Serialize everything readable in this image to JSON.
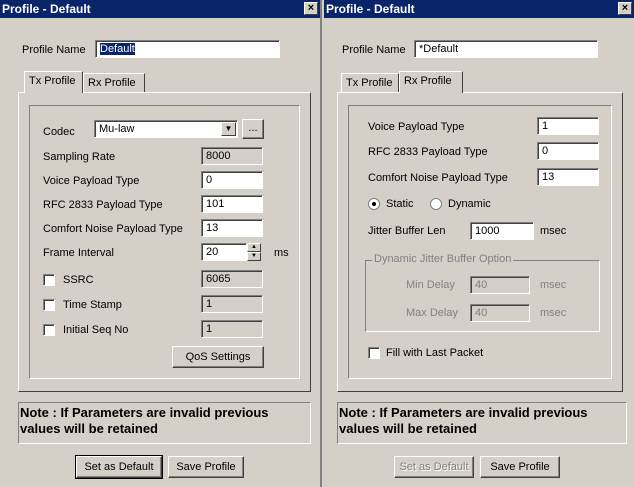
{
  "left": {
    "title": "Profile - Default",
    "close": "×",
    "profile_name_label": "Profile Name",
    "profile_name_value": "Default",
    "tabs": [
      "Tx Profile",
      "Rx Profile"
    ],
    "codec_label": "Codec",
    "codec_value": "Mu-law",
    "codec_more": "...",
    "sampling_rate_label": "Sampling Rate",
    "sampling_rate_value": "8000",
    "voice_payload_label": "Voice Payload Type",
    "voice_payload_value": "0",
    "rfc_label": "RFC 2833 Payload Type",
    "rfc_value": "101",
    "comfort_label": "Comfort Noise Payload Type",
    "comfort_value": "13",
    "frame_label": "Frame Interval",
    "frame_value": "20",
    "frame_unit": "ms",
    "ssrc_label": "SSRC",
    "ssrc_value": "6065",
    "timestamp_label": "Time Stamp",
    "timestamp_value": "1",
    "seq_label": "Initial Seq No",
    "seq_value": "1",
    "qos_button": "QoS Settings",
    "note": "Note : If Parameters are invalid previous values will be retained",
    "set_default_button": "Set as Default",
    "save_button": "Save Profile"
  },
  "right": {
    "title": "Profile - Default",
    "close": "×",
    "profile_name_label": "Profile Name",
    "profile_name_value": "*Default",
    "tabs": [
      "Tx Profile",
      "Rx Profile"
    ],
    "voice_payload_label": "Voice Payload Type",
    "voice_payload_value": "1",
    "rfc_label": "RFC 2833 Payload Type",
    "rfc_value": "0",
    "comfort_label": "Comfort Noise Payload Type",
    "comfort_value": "13",
    "static_label": "Static",
    "dynamic_label": "Dynamic",
    "jitter_label": "Jitter Buffer Len",
    "jitter_value": "1000",
    "jitter_unit": "msec",
    "group_label": "Dynamic Jitter Buffer Option",
    "min_delay_label": "Min Delay",
    "min_delay_value": "40",
    "min_delay_unit": "msec",
    "max_delay_label": "Max Delay",
    "max_delay_value": "40",
    "max_delay_unit": "msec",
    "fill_label": "Fill with Last Packet",
    "note": "Note : If Parameters are invalid previous values will be retained",
    "set_default_button": "Set as Default",
    "save_button": "Save Profile"
  },
  "colors": {
    "titlebar": "#0a246a",
    "face": "#d4d0c8"
  }
}
